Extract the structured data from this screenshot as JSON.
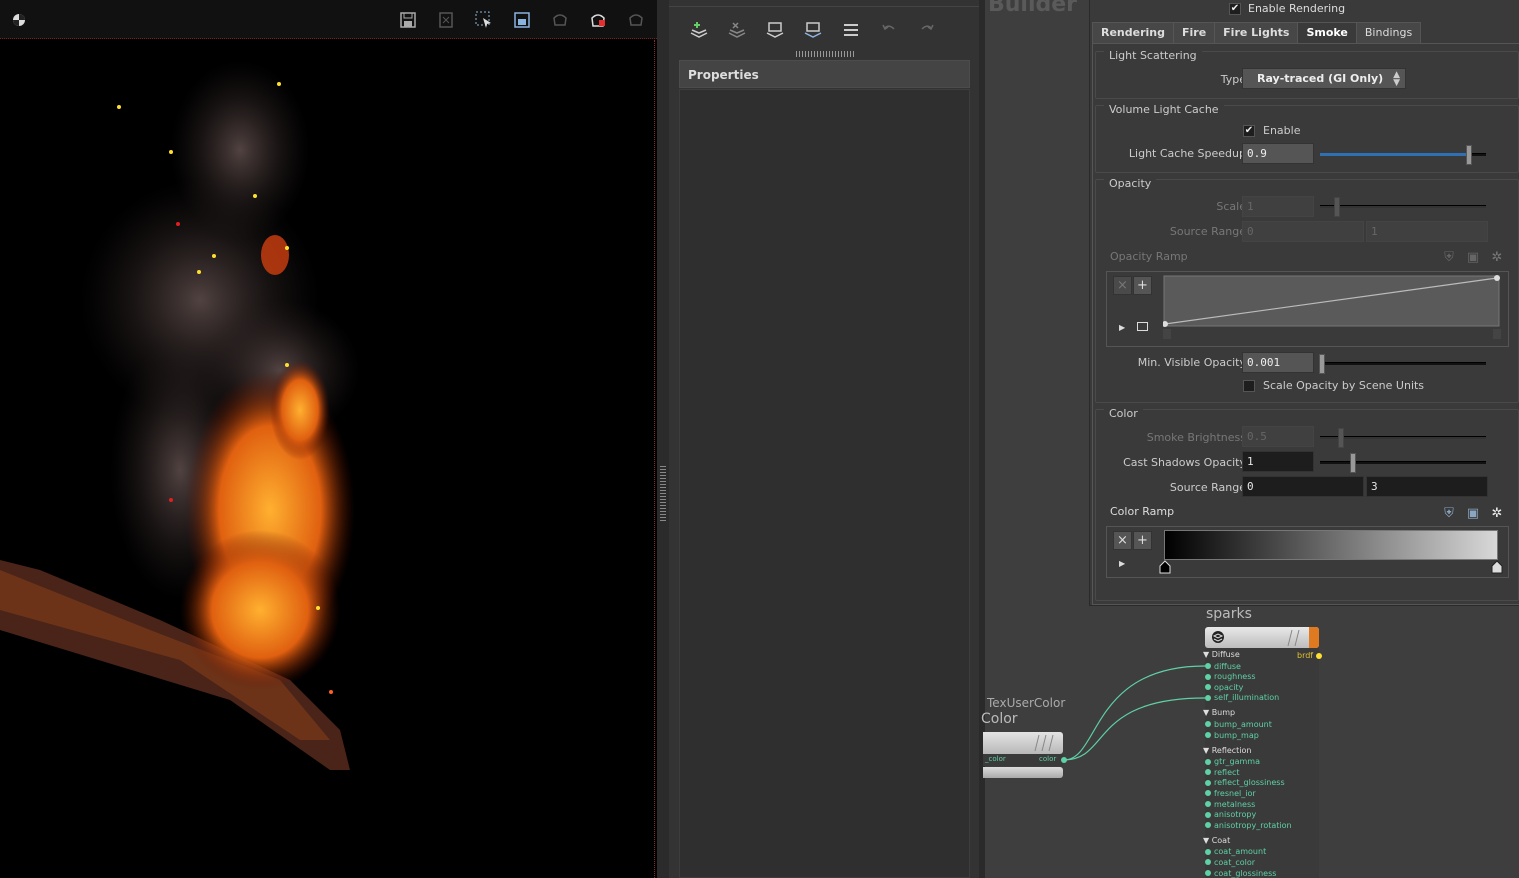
{
  "viewport_toolbar": {
    "icons": [
      "palette-icon",
      "save-icon",
      "export-icon",
      "select-icon",
      "frame-icon",
      "render-region-icon",
      "render-icon",
      "ipr-icon"
    ]
  },
  "middle_panel": {
    "toolbar_icons": [
      "add-layer-icon",
      "remove-layer-icon",
      "import-icon",
      "export-layer-icon",
      "list-icon",
      "undo-icon",
      "redo-icon"
    ],
    "properties_label": "Properties"
  },
  "network": {
    "background_title": "Builder",
    "tex_node_type": "TexUserColor",
    "tex_node_name": "Color",
    "tex_port_in": "_color",
    "tex_port_out": "color",
    "sparks_node_name": "sparks",
    "sparks_output": "brdf",
    "sections": [
      {
        "title": "Diffuse",
        "ports": [
          "diffuse",
          "roughness",
          "opacity",
          "self_illumination"
        ]
      },
      {
        "title": "Bump",
        "ports": [
          "bump_amount",
          "bump_map"
        ]
      },
      {
        "title": "Reflection",
        "ports": [
          "gtr_gamma",
          "reflect",
          "reflect_glossiness",
          "fresnel_ior",
          "metalness",
          "anisotropy",
          "anisotropy_rotation"
        ]
      },
      {
        "title": "Coat",
        "ports": [
          "coat_amount",
          "coat_color",
          "coat_glossiness"
        ]
      }
    ]
  },
  "params": {
    "enable_rendering": {
      "label": "Enable Rendering",
      "checked": true
    },
    "tabs": [
      "Rendering",
      "Fire",
      "Fire Lights",
      "Smoke",
      "Bindings"
    ],
    "active_tab": "Smoke",
    "light_scattering": {
      "title": "Light Scattering",
      "type_label": "Type",
      "type_value": "Ray-traced (GI Only)"
    },
    "volume_light_cache": {
      "title": "Volume Light Cache",
      "enable_label": "Enable",
      "enable_checked": true,
      "speedup_label": "Light Cache Speedup",
      "speedup_value": "0.9",
      "speedup_fraction": 0.9
    },
    "opacity": {
      "title": "Opacity",
      "scale_label": "Scale",
      "scale_value": "1",
      "source_range_label": "Source Range",
      "source_range_min": "0",
      "source_range_max": "1",
      "ramp_label": "Opacity Ramp",
      "min_visible_label": "Min. Visible Opacity",
      "min_visible_value": "0.001",
      "scale_by_units_label": "Scale Opacity by Scene Units",
      "scale_by_units_checked": false
    },
    "color": {
      "title": "Color",
      "smoke_brightness_label": "Smoke Brightness",
      "smoke_brightness_value": "0.5",
      "cast_shadows_label": "Cast Shadows Opacity",
      "cast_shadows_value": "1",
      "cast_shadows_fraction": 0.2,
      "source_range_label": "Source Range",
      "source_range_min": "0",
      "source_range_max": "3",
      "ramp_label": "Color Ramp"
    }
  }
}
